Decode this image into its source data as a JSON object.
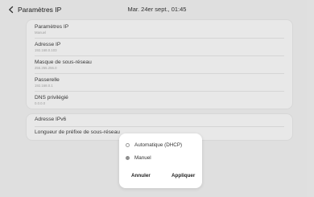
{
  "header": {
    "title": "Paramètres IP",
    "datetime": "Mar. 24er sept., 01:45"
  },
  "ip_settings": {
    "items": [
      {
        "label": "Paramètres IP",
        "value": "Manuel"
      },
      {
        "label": "Adresse IP",
        "value": "192.168.0.103"
      },
      {
        "label": "Masque de sous-réseau",
        "value": "255.255.255.0"
      },
      {
        "label": "Passerelle",
        "value": "192.168.0.1"
      },
      {
        "label": "DNS privilégié",
        "value": "0.0.0.0"
      }
    ]
  },
  "ipv6": {
    "items": [
      {
        "label": "Adresse IPv6"
      },
      {
        "label": "Longueur de préfixe de sous-réseau"
      }
    ]
  },
  "dialog": {
    "options": [
      {
        "label": "Automatique (DHCP)",
        "selected": false
      },
      {
        "label": "Manuel",
        "selected": true
      }
    ],
    "cancel_label": "Annuler",
    "apply_label": "Appliquer"
  }
}
